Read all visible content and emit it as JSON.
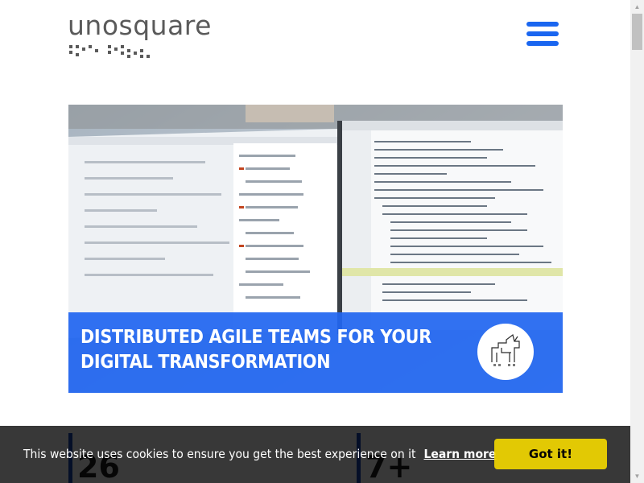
{
  "header": {
    "logo_text": "unosquare",
    "menu_icon": "hamburger-menu-icon"
  },
  "hero": {
    "title": "DISTRIBUTED AGILE TEAMS FOR YOUR DIGITAL TRANSFORMATION",
    "badge_icon": "pixel-unicorn-icon"
  },
  "stats": [
    {
      "value": "26"
    },
    {
      "value": "7+"
    }
  ],
  "cookie": {
    "message": "This website uses cookies to ensure you get the best experience on it",
    "learn_more": "Learn more",
    "accept": "Got it!"
  },
  "colors": {
    "accent": "#1a66f0",
    "banner": "#2166f0",
    "cookie_button": "#f1d600",
    "logo_text": "#5a5a5a"
  }
}
